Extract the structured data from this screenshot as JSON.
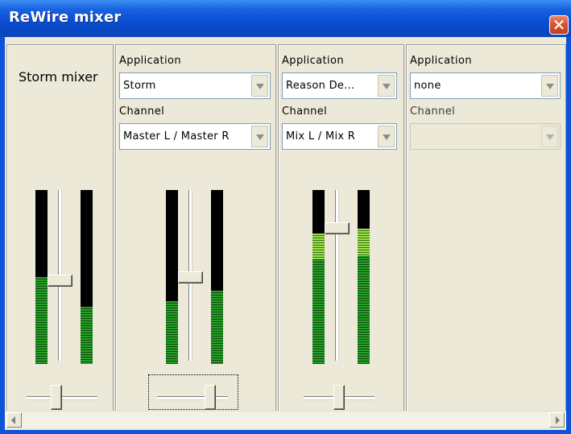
{
  "window": {
    "title": "ReWire mixer",
    "close_icon": "close-icon"
  },
  "master": {
    "label": "Storm mixer",
    "meter_left_level": 0.5,
    "meter_right_level": 0.33,
    "fader_level": 0.48,
    "pan": 0.4
  },
  "channels": [
    {
      "application_label": "Application",
      "application_value": "Storm",
      "channel_label": "Channel",
      "channel_value": "Master L / Master R",
      "meter_left_level": 0.36,
      "meter_right_level": 0.42,
      "fader_level": 0.5,
      "pan": 0.8
    },
    {
      "application_label": "Application",
      "application_value": "Reason De...",
      "channel_label": "Channel",
      "channel_value": "Mix L / Mix R",
      "meter_left_level": 0.75,
      "meter_right_level": 0.78,
      "fader_level": 0.8,
      "pan": 0.5
    },
    {
      "application_label": "Application",
      "application_value": "none",
      "channel_label": "Channel",
      "channel_value": ""
    }
  ],
  "colors": {
    "title_bar": "#0b53d8",
    "client_bg": "#ece9d8",
    "meter_green": "#2a9e2a",
    "meter_peak": "#9be24c",
    "close_red": "#d9542f"
  }
}
